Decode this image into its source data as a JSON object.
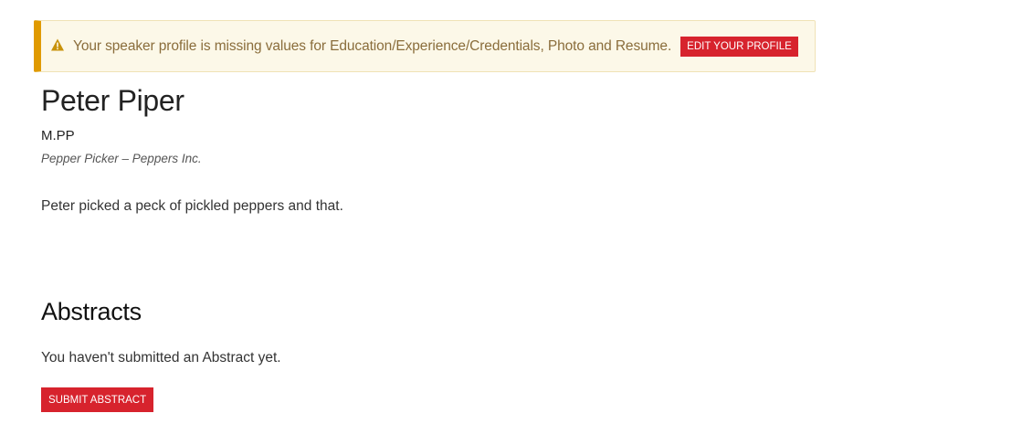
{
  "alert": {
    "icon": "warning-icon",
    "message": "Your speaker profile is missing values for Education/Experience/Credentials, Photo and Resume.",
    "button_label": "EDIT YOUR PROFILE"
  },
  "speaker": {
    "name": "Peter Piper",
    "credentials": "M.PP",
    "position": "Pepper Picker – Peppers Inc.",
    "bio": "Peter picked a peck of pickled peppers and that."
  },
  "abstracts": {
    "heading": "Abstracts",
    "empty_text": "You haven't submitted an Abstract yet.",
    "submit_label": "SUBMIT ABSTRACT"
  },
  "colors": {
    "accent": "#d7232d",
    "alert_border": "#e09a00",
    "alert_background": "#fcf8e8",
    "alert_text": "#8a6d3b"
  }
}
